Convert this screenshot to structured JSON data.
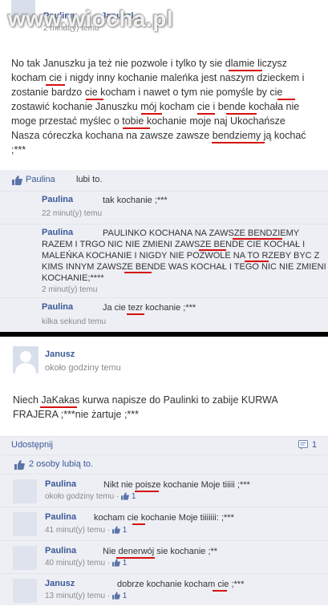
{
  "watermark": "www.wiocha.pl",
  "top_post": {
    "author": "Paulina",
    "author_suffix": "Januszl",
    "time": "2 minut(y) temu",
    "message_lines": [
      "No tak Januszku ja też nie pozwole i tylko ty sie dlamie liczysz",
      "kocham cie i nigdy inny kochanie maleńka jest naszym dzieckem i",
      "zostanie bardzo cie kocham i nawet o tym nie pomyśle by cie",
      "zostawić kochanie Januszku mój kocham cie i bende kochała nie",
      "moge przestać myślec o tobie kochanie moje naj Ukochańsze",
      "Nasza córeczka kochana na zawsze zawsze bendziemy ją kochać",
      ";***"
    ],
    "likes": {
      "name": "Paulina",
      "text": "lubi to."
    },
    "comments": [
      {
        "name": "Paulina",
        "text_lines": [
          "tak kochanie ;***"
        ],
        "time": "22 minut(y) temu"
      },
      {
        "name": "Paulina",
        "text_lines": [
          "PAULINKO KOCHANA NA ZAWSZE BENDZIEMY",
          "RAZEM I TRGO NIC NIE ZMIENI ZAWSZE BENDE CIE KOCHAŁ I",
          "MALEŃKA KOCHANIE I NIGDY NIE POZWOLE NA TO RZEBY BYC Z",
          "KIMS INNYM ZAWSZE BENDE WAS KOCHAŁ I TEGO NIC NIE ZMIENI",
          "KOCHANIE;****"
        ],
        "time": "2 minut(y) temu"
      },
      {
        "name": "Paulina",
        "text_lines": [
          "Ja cie tezr kochanie ;***"
        ],
        "time": "kilka sekund temu"
      }
    ]
  },
  "bottom_post": {
    "author": "Janusz",
    "time": "około godziny temu",
    "message_lines": [
      "Niech JaKakas kurwa napisze do Paulinki to zabije KURWA",
      "FRAJERA ;***nie żartuje ;***"
    ],
    "share_label": "Udostępnij",
    "comment_count": "1",
    "likes": {
      "text": "2 osoby lubią to."
    },
    "comments": [
      {
        "name": "Paulina",
        "text": "Nikt nie poisze kochanie Moje tiiiii ;***",
        "time": "około godziny temu",
        "likes": "1"
      },
      {
        "name": "Paulina",
        "text": "kocham cie kochanie Moje tiiiiiii: ;***",
        "time": "41 minut(y) temu",
        "likes": "1"
      },
      {
        "name": "Paulina",
        "text": "Nie denerwój sie kochanie ;**",
        "time": "40 minut(y) temu",
        "likes": "1"
      },
      {
        "name": "Janusz",
        "text": "dobrze kochanie kocham cie ;***",
        "time": "13 minut(y) temu",
        "likes": "1"
      }
    ]
  },
  "colors": {
    "link": "#3b5998",
    "panel": "#edeff4",
    "underline": "#d61010",
    "separator": "#000000"
  }
}
